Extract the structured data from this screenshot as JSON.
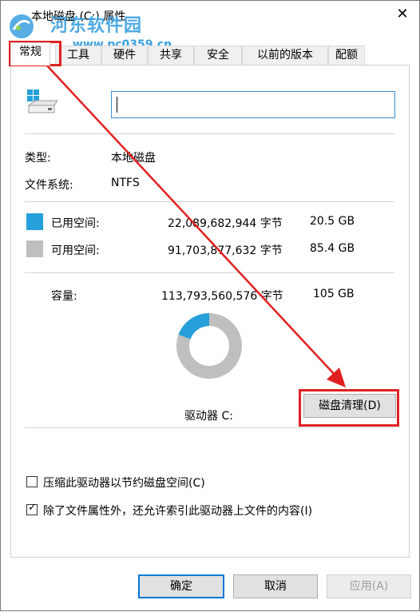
{
  "window": {
    "title": "本地磁盘 (C:) 属性",
    "close_glyph": "✕"
  },
  "watermark": {
    "site_name": "河东软件园",
    "url": "www.pc0359.cn"
  },
  "tabs": [
    {
      "label": "常规",
      "active": true
    },
    {
      "label": "工具",
      "active": false
    },
    {
      "label": "硬件",
      "active": false
    },
    {
      "label": "共享",
      "active": false
    },
    {
      "label": "安全",
      "active": false
    },
    {
      "label": "以前的版本",
      "active": false
    },
    {
      "label": "配额",
      "active": false
    }
  ],
  "general": {
    "drive_name_value": "",
    "type_label": "类型:",
    "type_value": "本地磁盘",
    "fs_label": "文件系统:",
    "fs_value": "NTFS",
    "used_label": "已用空间:",
    "used_bytes": "22,089,682,944 字节",
    "used_gb": "20.5 GB",
    "free_label": "可用空间:",
    "free_bytes": "91,703,877,632 字节",
    "free_gb": "85.4 GB",
    "capacity_label": "容量:",
    "capacity_bytes": "113,793,560,576 字节",
    "capacity_gb": "105 GB",
    "drive_label": "驱动器 C:",
    "cleanup_button": "磁盘清理(D)",
    "used_fraction": 0.194,
    "used_color": "#26a0da",
    "free_color": "#bfbfbf",
    "compress_label": "压缩此驱动器以节约磁盘空间(C)",
    "compress_checked": false,
    "index_label": "除了文件属性外，还允许索引此驱动器上文件的内容(I)",
    "index_checked": true
  },
  "footer": {
    "ok_label": "确定",
    "cancel_label": "取消",
    "apply_label": "应用(A)"
  },
  "annotation_color": "#e02020"
}
